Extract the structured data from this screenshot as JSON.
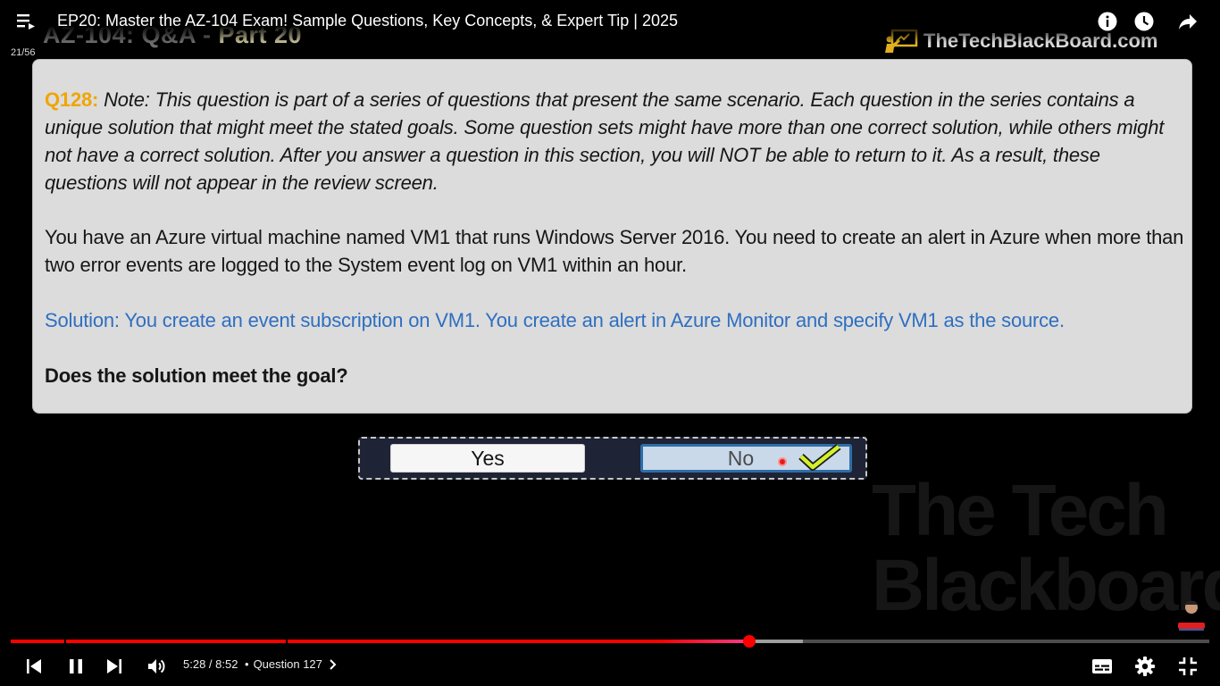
{
  "player": {
    "title": "EP20: Master the AZ-104 Exam! Sample Questions, Key Concepts, & Expert Tip | 2025",
    "playlist_counter": "21/56",
    "time": "5:28 / 8:52",
    "chapter_separator": "•",
    "chapter": "Question 127",
    "progress_fraction": 0.6165,
    "buffered_fraction": 0.661,
    "colors": {
      "played": "#ff0000",
      "buffered": "#9e9e9e",
      "remaining": "#4d4d4d"
    }
  },
  "slide": {
    "heading": "AZ-104: Q&A - ",
    "heading_part": "Part 20",
    "brand": "TheTechBlackBoard.com",
    "question_number": "Q128:",
    "note": "Note: This question is part of a series of questions that present the same scenario. Each question in the series contains a unique solution that might meet the stated goals. Some question sets might have more than one correct solution, while others might not have a correct solution. After you answer a question in this section, you will NOT be able to return to it. As a result, these questions will not appear in the review screen.",
    "scenario": "You have an Azure virtual machine named VM1 that runs Windows Server 2016. You need to create an alert in Azure when more than two error events are logged to the System event log on VM1 within an hour.",
    "solution": "Solution: You create an event subscription on VM1. You create an alert in Azure Monitor and specify VM1 as the source.",
    "prompt": "Does the solution meet the goal?",
    "answers": {
      "yes": "Yes",
      "no": "No"
    },
    "watermark": [
      "The Tech",
      "Blackboard"
    ]
  },
  "icons": {
    "playlist": "playlist-icon",
    "info": "info-icon",
    "watch_later": "clock-icon",
    "share": "share-icon",
    "previous": "skip-previous-icon",
    "pause": "pause-icon",
    "next": "skip-next-icon",
    "volume": "volume-icon",
    "chapter_arrow": "chevron-right-icon",
    "subtitles": "subtitles-icon",
    "settings": "gear-icon",
    "exit_fullscreen": "exit-fullscreen-icon",
    "correct": "check-icon"
  }
}
